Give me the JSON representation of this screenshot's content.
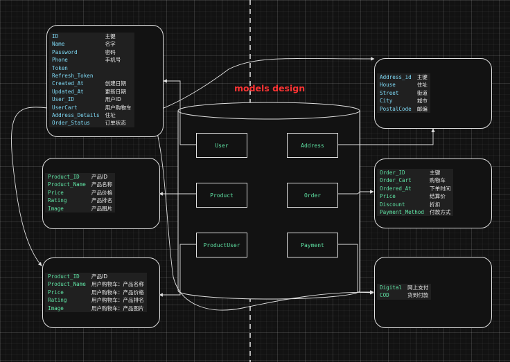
{
  "title": "models design",
  "entities": {
    "user": "User",
    "address": "Address",
    "product": "Product",
    "order": "Order",
    "product_user": "ProductUser",
    "payment": "Payment"
  },
  "tables": {
    "user": {
      "rows": [
        {
          "k": "ID",
          "v": "主键"
        },
        {
          "k": "Name",
          "v": "名字"
        },
        {
          "k": "Password",
          "v": "密码"
        },
        {
          "k": "Phone",
          "v": "手机号"
        },
        {
          "k": "Token",
          "v": ""
        },
        {
          "k": "Refresh_Token",
          "v": ""
        },
        {
          "k": "Created_At",
          "v": "创建日期"
        },
        {
          "k": "Updated_At",
          "v": "更新日期"
        },
        {
          "k": "User_ID",
          "v": "用户ID"
        },
        {
          "k": "UserCart",
          "v": "用户购物车"
        },
        {
          "k": "Address_Details",
          "v": "住址"
        },
        {
          "k": "Order_Status",
          "v": "订单状态"
        }
      ]
    },
    "address": {
      "rows": [
        {
          "k": "Address_id",
          "v": "主键"
        },
        {
          "k": "House",
          "v": "住址"
        },
        {
          "k": "Street",
          "v": "街道"
        },
        {
          "k": "City",
          "v": "城市"
        },
        {
          "k": "PostalCode",
          "v": "邮编"
        }
      ]
    },
    "product": {
      "rows": [
        {
          "k": "Product_ID",
          "v": "产品ID"
        },
        {
          "k": "Product_Name",
          "v": "产品名称"
        },
        {
          "k": "Price",
          "v": "产品价格"
        },
        {
          "k": "Rating",
          "v": "产品排名"
        },
        {
          "k": "Image",
          "v": "产品图片"
        }
      ]
    },
    "order": {
      "rows": [
        {
          "k": "Order_ID",
          "v": "主键"
        },
        {
          "k": "Order_Cart",
          "v": "购物车"
        },
        {
          "k": "Ordered_At",
          "v": "下单时间"
        },
        {
          "k": "Price",
          "v": "结算价"
        },
        {
          "k": "Discount",
          "v": "折扣"
        },
        {
          "k": "Payment_Method",
          "v": "付款方式"
        }
      ]
    },
    "product_user": {
      "rows": [
        {
          "k": "Product_ID",
          "v": "产品ID"
        },
        {
          "k": "Product_Name",
          "v": "用户购物车：产品名称"
        },
        {
          "k": "Price",
          "v": "用户购物车：产品价格"
        },
        {
          "k": "Rating",
          "v": "用户购物车：产品排名"
        },
        {
          "k": "Image",
          "v": "用户购物车：产品图片"
        }
      ]
    },
    "payment": {
      "rows": [
        {
          "k": "Digital",
          "v": "网上支付"
        },
        {
          "k": "COD",
          "v": "货到付款"
        }
      ]
    }
  }
}
